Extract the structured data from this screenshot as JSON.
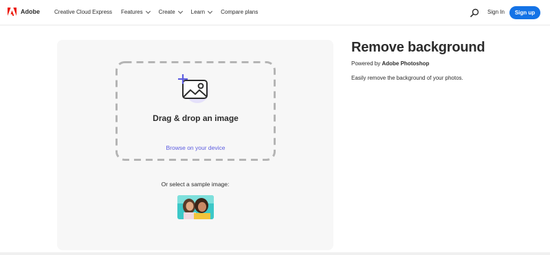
{
  "brand": {
    "name": "Adobe",
    "color": "#eb1000"
  },
  "nav": {
    "items": [
      {
        "label": "Creative Cloud Express",
        "dropdown": false
      },
      {
        "label": "Features",
        "dropdown": true
      },
      {
        "label": "Create",
        "dropdown": true
      },
      {
        "label": "Learn",
        "dropdown": true
      },
      {
        "label": "Compare plans",
        "dropdown": false
      }
    ],
    "search_icon": "search-icon",
    "sign_in": "Sign In",
    "sign_up": "Sign up",
    "accent": "#1473e6"
  },
  "upload": {
    "icon": "add-image-icon",
    "title": "Drag & drop an image",
    "browse": "Browse on your device",
    "link_color": "#5c5ce0",
    "sample_label": "Or select a sample image:"
  },
  "info": {
    "title": "Remove background",
    "powered_prefix": "Powered by ",
    "powered_product": "Adobe Photoshop",
    "description": "Easily remove the background of your photos."
  }
}
